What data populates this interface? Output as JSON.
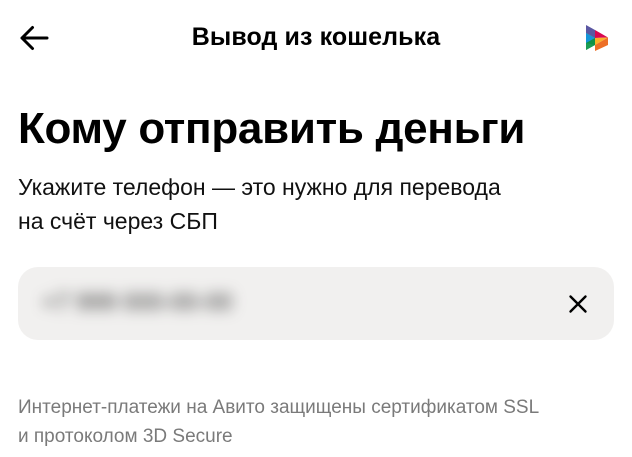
{
  "header": {
    "title": "Вывод из кошелька",
    "back_icon": "arrow-left-icon",
    "logo_icon": "sbp-logo-icon"
  },
  "main": {
    "heading": "Кому отправить деньги",
    "subtitle_line1": "Укажите телефон — это нужно для перевода",
    "subtitle_line2": "на счёт через СБП",
    "phone_input": {
      "value": "+7 999 000-00-00",
      "clear_icon": "close-icon"
    },
    "footnote_line1": "Интернет-платежи на Авито защищены сертификатом SSL",
    "footnote_line2": "и протоколом 3D Secure"
  },
  "colors": {
    "field_background": "#f1f0ef",
    "footnote_text": "#7a7a7a"
  }
}
